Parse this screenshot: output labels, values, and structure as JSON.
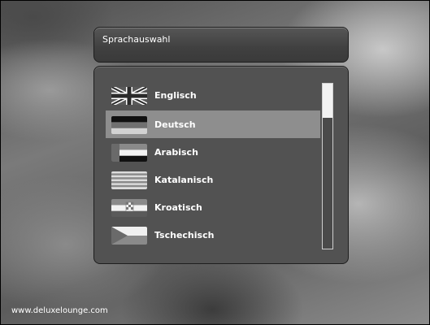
{
  "dialog": {
    "title": "Sprachauswahl"
  },
  "languages": [
    {
      "label": "Englisch",
      "flag": "flag-uk-icon",
      "selected": false
    },
    {
      "label": "Deutsch",
      "flag": "flag-germany-icon",
      "selected": true
    },
    {
      "label": "Arabisch",
      "flag": "flag-arab-icon",
      "selected": false
    },
    {
      "label": "Katalanisch",
      "flag": "flag-catalonia-icon",
      "selected": false
    },
    {
      "label": "Kroatisch",
      "flag": "flag-croatia-icon",
      "selected": false
    },
    {
      "label": "Tschechisch",
      "flag": "flag-czech-icon",
      "selected": false
    }
  ],
  "footer": {
    "text": "www.deluxelounge.com"
  },
  "colors": {
    "selection": "#8e8e8e",
    "panel": "#525252"
  }
}
